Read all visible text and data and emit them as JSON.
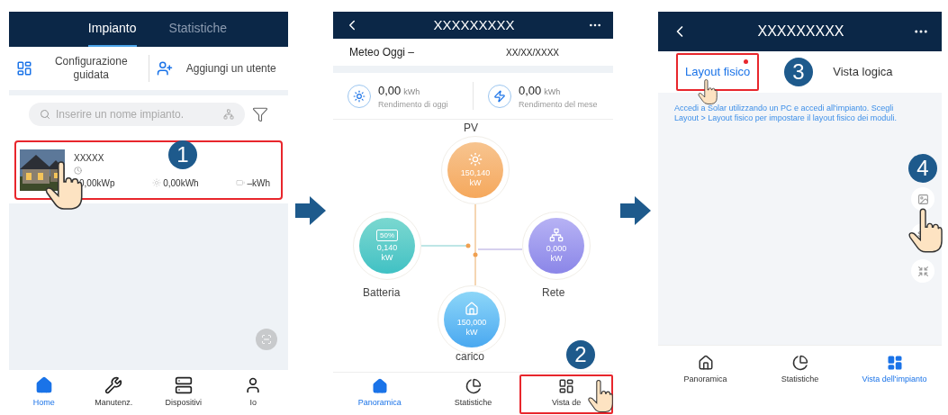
{
  "screen_1": {
    "tabs": [
      {
        "label": "Impianto",
        "selected": true
      },
      {
        "label": "Statistiche",
        "selected": false
      }
    ],
    "actions": [
      {
        "label": "Configurazione guidata"
      },
      {
        "label": "Aggiungi un utente"
      }
    ],
    "search": {
      "placeholder": "Inserire un nome impianto."
    },
    "plant": {
      "name": "XXXXX",
      "capacity": "0,00kWp",
      "yield": "0,00kWh",
      "battery": "–kWh",
      "highlighted": true
    },
    "step": "1",
    "nav": [
      {
        "label": "Home",
        "selected": true
      },
      {
        "label": "Manutenz.",
        "selected": false
      },
      {
        "label": "Dispositivi",
        "selected": false
      },
      {
        "label": "Io",
        "selected": false
      }
    ]
  },
  "screen_2": {
    "title": "XXXXXXXXX",
    "weather": "Meteo Oggi –",
    "date": "XX/XX/XXXX",
    "stats": [
      {
        "value": "0,00",
        "unit": "kWh",
        "label": "Rendimento di oggi"
      },
      {
        "value": "0,00",
        "unit": "kWh",
        "label": "Rendimento del mese"
      }
    ],
    "flow": {
      "pv": {
        "label": "PV",
        "value": "150,140",
        "unit": "kW"
      },
      "battery": {
        "label": "Batteria",
        "value": "0,140",
        "unit": "kW",
        "soc": "50%"
      },
      "grid": {
        "label": "Rete",
        "value": "0,000",
        "unit": "kW"
      },
      "load": {
        "label": "carico",
        "value": "150,000",
        "unit": "kW"
      }
    },
    "step": "2",
    "nav": [
      {
        "label": "Panoramica",
        "selected": true,
        "highlighted": false
      },
      {
        "label": "Statistiche",
        "selected": false,
        "highlighted": false
      },
      {
        "label": "Vista de",
        "selected": false,
        "highlighted": true
      }
    ]
  },
  "screen_3": {
    "title": "XXXXXXXXX",
    "tabs": [
      {
        "label": "Layout fisico",
        "selected": true,
        "notification": true,
        "highlighted": true
      },
      {
        "label": "Vista logica",
        "selected": false,
        "notification": false,
        "highlighted": false
      }
    ],
    "hint": "Accedi a Solar utilizzando un PC e accedi all'impianto. Scegli Layout > Layout fisico per impostare il layout fisico dei moduli.",
    "steps": [
      "3",
      "4"
    ],
    "nav": [
      {
        "label": "Panoramica",
        "selected": false
      },
      {
        "label": "Statistiche",
        "selected": false
      },
      {
        "label": "Vista dell'impianto",
        "selected": true
      }
    ]
  }
}
